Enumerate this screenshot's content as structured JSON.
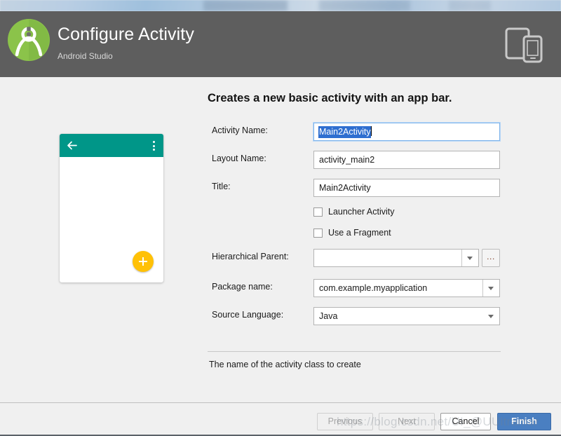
{
  "header": {
    "title": "Configure Activity",
    "subtitle": "Android Studio",
    "logo_icon": "android-studio-logo-icon",
    "device_icon": "tablet-and-phone-icon"
  },
  "preview": {
    "name": "basic-activity-preview",
    "appbar_color": "#009688",
    "fab_color": "#ffc107",
    "back_icon": "back-arrow-icon",
    "overflow_icon": "overflow-menu-icon",
    "fab_icon": "plus-icon"
  },
  "form": {
    "heading": "Creates a new basic activity with an app bar.",
    "fields": {
      "activity_name": {
        "label": "Activity Name:",
        "value": "Main2Activity",
        "focused": true,
        "selected": true
      },
      "layout_name": {
        "label": "Layout Name:",
        "value": "activity_main2"
      },
      "title": {
        "label": "Title:",
        "value": "Main2Activity"
      },
      "hierarchical_parent": {
        "label": "Hierarchical Parent:",
        "value": "",
        "browse_label": "...",
        "dropdown_icon": "chevron-down-icon"
      },
      "package_name": {
        "label": "Package name:",
        "value": "com.example.myapplication",
        "dropdown_icon": "chevron-down-icon"
      },
      "source_language": {
        "label": "Source Language:",
        "value": "Java",
        "dropdown_icon": "chevron-down-icon"
      }
    },
    "checkboxes": [
      {
        "label": "Launcher Activity",
        "checked": false
      },
      {
        "label": "Use a Fragment",
        "checked": false
      }
    ],
    "hint": "The name of the activity class to create"
  },
  "footer": {
    "previous": {
      "label": "Previous",
      "enabled": false
    },
    "next": {
      "label": "Next",
      "enabled": false
    },
    "cancel": {
      "label": "Cancel",
      "enabled": true
    },
    "finish": {
      "label": "Finish",
      "enabled": true,
      "color": "#4a7fc1"
    }
  },
  "watermark": "https://blog.csdn.net/UI_@UUltramar"
}
